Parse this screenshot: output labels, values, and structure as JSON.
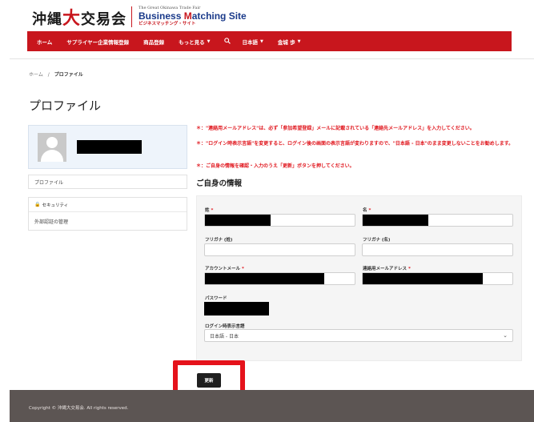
{
  "brand": {
    "logo_prefix": "沖縄",
    "logo_big": "大",
    "logo_suffix": "交易会",
    "trade_fair": "The Great Okinawa Trade Fair",
    "site_prefix": "Business ",
    "site_mid": "M",
    "site_suffix": "atching Site",
    "site_jp": "ビジネスマッチング・サイト"
  },
  "nav": {
    "home": "ホーム",
    "supplier": "サプライヤー企業情報登録",
    "product": "商品登録",
    "more": "もっと見る",
    "search_icon": "magnifier",
    "language": "日本語",
    "user": "金城 歩"
  },
  "breadcrumb": {
    "home": "ホーム",
    "sep": "/",
    "current": "プロファイル"
  },
  "page_title": "プロファイル",
  "sidebar": {
    "profile_link": "プロファイル",
    "security_heading": "セキュリティ",
    "external_auth": "外部認証の管理"
  },
  "notices": [
    "＊：\"連絡用メールアドレス\"は、必ず「参加希望登録」メールに記載されている「連絡先メールアドレス」を入力してください。",
    "＊：\"ログイン時表示言語\"を変更すると、ログイン後の画面の表示言語が変わりますので、\"日本語 - 日本\"のまま変更しないことをお勧めします。",
    "＊：ご自身の情報を確認・入力のうえ「更新」ボタンを押してください。"
  ],
  "section_title": "ご自身の情報",
  "form": {
    "last_name_label": "姓",
    "first_name_label": "名",
    "kana_last_label": "フリガナ (姓)",
    "kana_first_label": "フリガナ (名)",
    "account_email_label": "アカウントメール",
    "contact_email_label": "連絡用メールアドレス",
    "password_label": "パスワード",
    "language_label": "ログイン時表示言語",
    "language_value": "日本語 - 日本",
    "required_mark": "*"
  },
  "update_button": "更新",
  "footer": {
    "copyright": "Copyright © 沖縄大交易会. All rights reserved."
  },
  "colors": {
    "brand_red": "#c8161d",
    "notice_red": "#e0161d",
    "footer_bg": "#5c5553",
    "highlight": "#e5121b"
  }
}
